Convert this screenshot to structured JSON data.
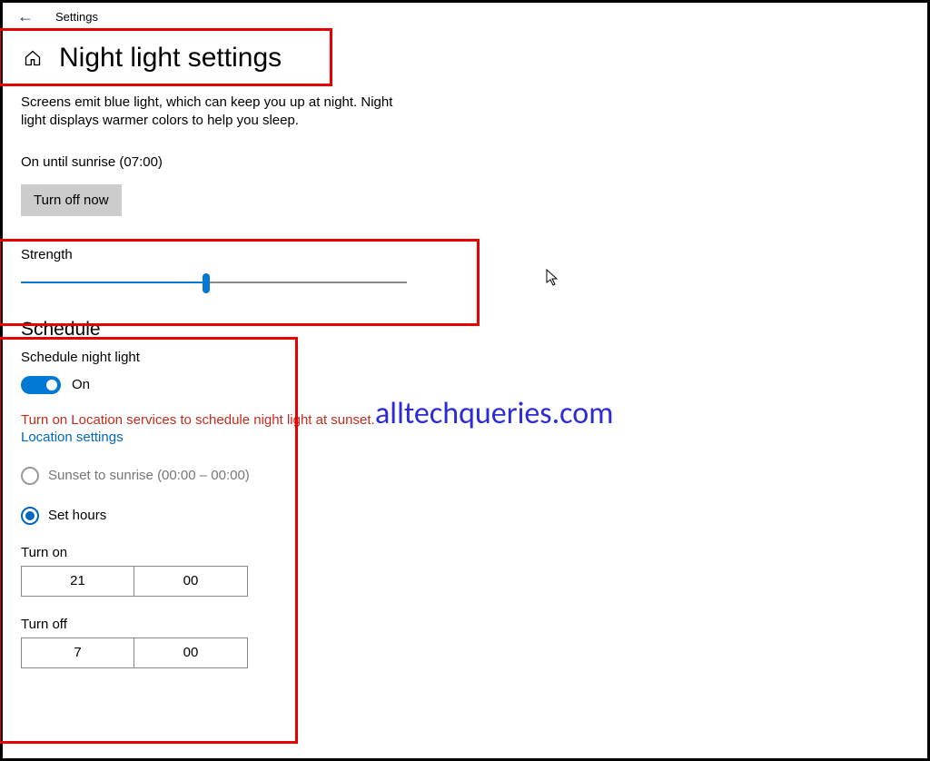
{
  "topbar": {
    "title": "Settings"
  },
  "header": {
    "title": "Night light settings"
  },
  "description": "Screens emit blue light, which can keep you up at night. Night light displays warmer colors to help you sleep.",
  "status": "On until sunrise (07:00)",
  "turn_off_btn": "Turn off now",
  "strength": {
    "label": "Strength",
    "value_percent": 48
  },
  "schedule": {
    "heading": "Schedule",
    "toggle_label": "Schedule night light",
    "toggle_state": "On",
    "warning": "Turn on Location services to schedule night light at sunset.",
    "location_link": "Location settings",
    "option_sunset": "Sunset to sunrise (00:00 – 00:00)",
    "option_set_hours": "Set hours",
    "turn_on_label": "Turn on",
    "turn_on_hour": "21",
    "turn_on_min": "00",
    "turn_off_label": "Turn off",
    "turn_off_hour": "7",
    "turn_off_min": "00"
  },
  "watermark": "alltechqueries.com"
}
